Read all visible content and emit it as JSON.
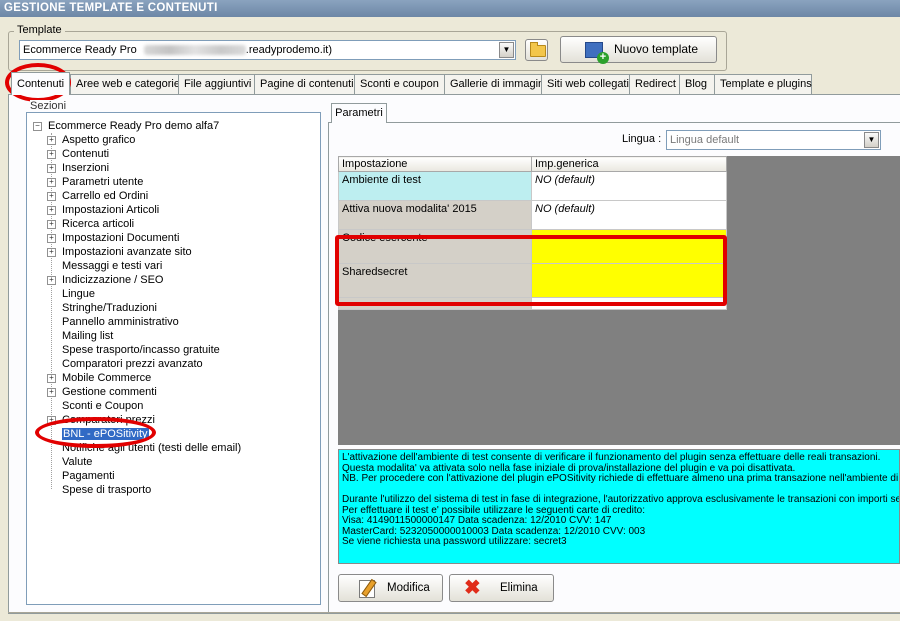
{
  "window": {
    "title": "GESTIONE TEMPLATE E CONTENUTI"
  },
  "template": {
    "group_label": "Template",
    "selected_prefix": "Ecommerce Ready Pro",
    "selected_suffix": ".readyprodemo.it)",
    "new_button": "Nuovo template"
  },
  "tabs": [
    "Contenuti",
    "Aree web e categorie",
    "File aggiuntivi",
    "Pagine di contenuti",
    "Sconti e coupon",
    "Gallerie di immagini",
    "Siti web collegati",
    "Redirect",
    "Blog",
    "Template e plugins"
  ],
  "tree": {
    "label": "Sezioni",
    "root": "Ecommerce Ready Pro demo alfa7",
    "items": [
      {
        "label": "Aspetto grafico",
        "expandable": true
      },
      {
        "label": "Contenuti",
        "expandable": true
      },
      {
        "label": "Inserzioni",
        "expandable": true
      },
      {
        "label": "Parametri utente",
        "expandable": true
      },
      {
        "label": "Carrello ed Ordini",
        "expandable": true
      },
      {
        "label": "Impostazioni Articoli",
        "expandable": true
      },
      {
        "label": "Ricerca articoli",
        "expandable": true
      },
      {
        "label": "Impostazioni Documenti",
        "expandable": true
      },
      {
        "label": "Impostazioni avanzate sito",
        "expandable": true
      },
      {
        "label": "Messaggi e testi vari",
        "expandable": false
      },
      {
        "label": "Indicizzazione / SEO",
        "expandable": true
      },
      {
        "label": "Lingue",
        "expandable": false
      },
      {
        "label": "Stringhe/Traduzioni",
        "expandable": false
      },
      {
        "label": "Pannello amministrativo",
        "expandable": false
      },
      {
        "label": "Mailing list",
        "expandable": false
      },
      {
        "label": "Spese trasporto/incasso gratuite",
        "expandable": false
      },
      {
        "label": "Comparatori prezzi avanzato",
        "expandable": false
      },
      {
        "label": "Mobile Commerce",
        "expandable": true
      },
      {
        "label": "Gestione commenti",
        "expandable": true
      },
      {
        "label": "Sconti e Coupon",
        "expandable": false
      },
      {
        "label": "Comparatori prezzi",
        "expandable": true
      },
      {
        "label": "BNL - ePOSitivity",
        "expandable": false,
        "selected": true
      },
      {
        "label": "Notifiche agli utenti (testi delle email)",
        "expandable": false
      },
      {
        "label": "Valute",
        "expandable": false
      },
      {
        "label": "Pagamenti",
        "expandable": false
      },
      {
        "label": "Spese di trasporto",
        "expandable": false
      }
    ]
  },
  "parametri": {
    "tab": "Parametri",
    "lingua_label": "Lingua :",
    "lingua_value": "Lingua default",
    "columns": [
      "Impostazione",
      "Imp.generica"
    ],
    "rows": [
      {
        "key": "Ambiente di test",
        "value": "NO (default)"
      },
      {
        "key": "Attiva nuova modalita' 2015",
        "value": "NO (default)"
      },
      {
        "key": "Codice esercente",
        "value": ""
      },
      {
        "key": "Sharedsecret",
        "value": ""
      }
    ]
  },
  "info_lines": [
    "L'attivazione dell'ambiente di test consente di verificare il funzionamento del plugin senza effettuare delle reali transazioni.",
    "Questa modalita' va attivata solo nella fase iniziale di prova/installazione del plugin e va poi disattivata.",
    "NB. Per procedere con l'attivazione del plugin ePOSitivity richiede di effettuare almeno una prima transazione nell'ambiente di",
    "",
    "Durante l'utilizzo del sistema di test in fase di integrazione, l'autorizzativo approva esclusivamente le transazioni con importi senz",
    "Per effettuare il test e' possibile utilizzare le seguenti carte di credito:",
    "Visa: 4149011500000147 Data scadenza: 12/2010 CVV: 147",
    "MasterCard: 5232050000010003 Data scadenza: 12/2010 CVV: 003",
    "Se viene richiesta una password utilizzare: secret3"
  ],
  "actions": {
    "modifica": "Modifica",
    "elimina": "Elimina"
  },
  "colors": {
    "highlight_ring": "#e10000",
    "info_bg": "#00ffff",
    "empty_value": "#ffff00",
    "test_row": "#bdeef0"
  }
}
